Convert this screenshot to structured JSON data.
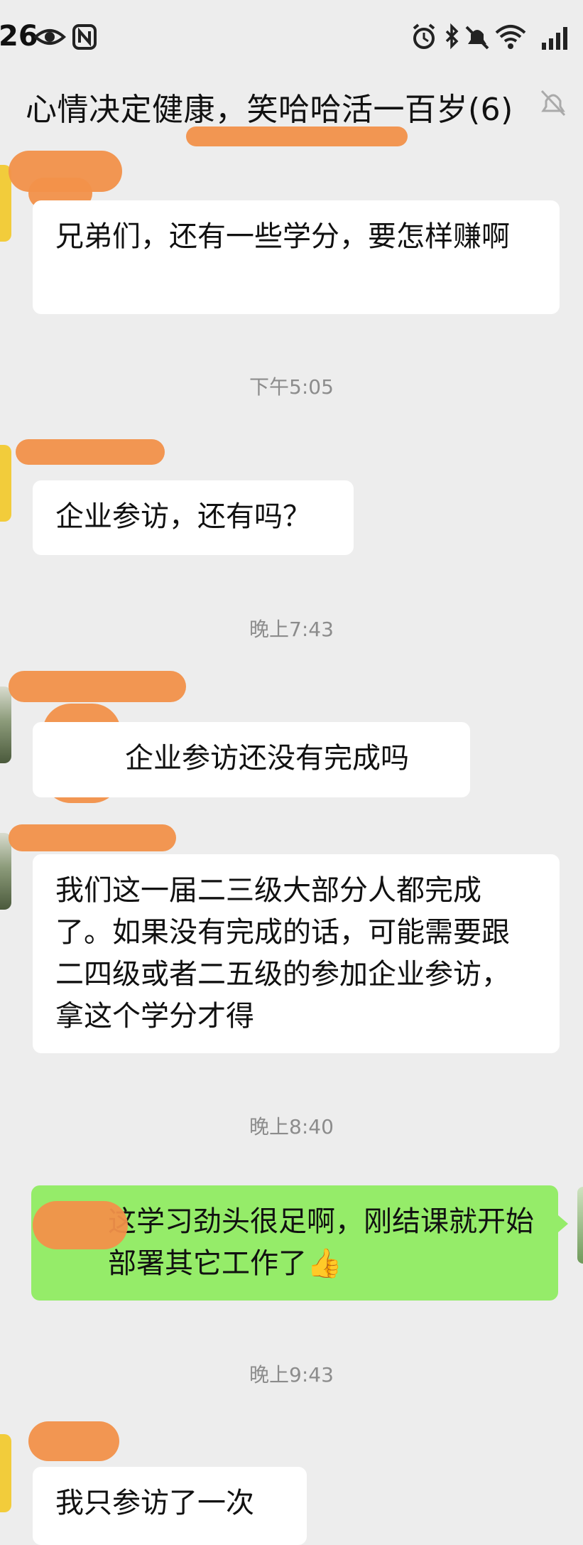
{
  "status_bar": {
    "time": "26"
  },
  "chat": {
    "title": "心情决定健康，笑哈哈活一百岁(6)"
  },
  "messages": [
    {
      "text": "兄弟们，还有一些学分，要怎样赚啊"
    },
    {
      "text": "企业参访，还有吗？"
    },
    {
      "text": "企业参访还没有完成吗"
    },
    {
      "text": "我们这一届二三级大部分人都完成了。如果没有完成的话，可能需要跟二四级或者二五级的参加企业参访，拿这个学分才得"
    },
    {
      "text": "这学习劲头很足啊，刚结课就开始部署其它工作了👍"
    },
    {
      "text": "我只参访了一次"
    }
  ],
  "timestamps": [
    "下午5:05",
    "晚上7:43",
    "晚上8:40",
    "晚上9:43"
  ]
}
